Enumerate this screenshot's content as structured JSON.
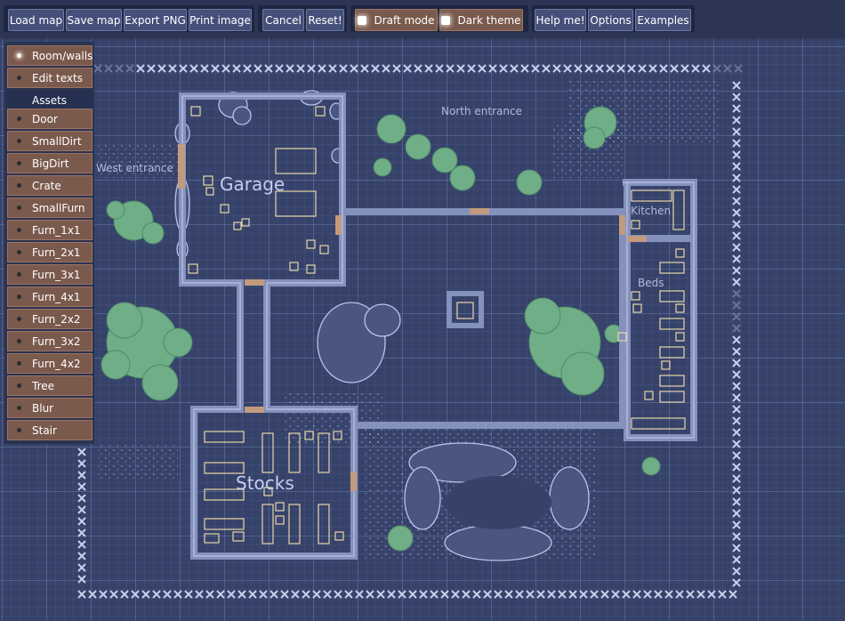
{
  "toolbar": {
    "file_buttons": [
      "Load map",
      "Save map",
      "Export PNG",
      "Print image"
    ],
    "edit_buttons": [
      "Cancel",
      "Reset!"
    ],
    "toggles": [
      {
        "label": "Draft mode",
        "checked": false
      },
      {
        "label": "Dark theme",
        "checked": false
      }
    ],
    "help_buttons": [
      "Help me!",
      "Options",
      "Examples"
    ]
  },
  "tool_panel": {
    "modes": [
      {
        "label": "Room/walls",
        "active": true
      },
      {
        "label": "Edit texts",
        "active": false
      }
    ],
    "assets_heading": "Assets",
    "assets": [
      "Door",
      "SmallDirt",
      "BigDirt",
      "Crate",
      "SmallFurn",
      "Furn_1x1",
      "Furn_2x1",
      "Furn_3x1",
      "Furn_4x1",
      "Furn_2x2",
      "Furn_3x2",
      "Furn_4x2",
      "Tree",
      "Blur",
      "Stair"
    ]
  },
  "map_labels": {
    "garage": "Garage",
    "stocks": "Stocks",
    "kitchen": "Kitchen",
    "beds": "Beds",
    "north_entrance": "North entrance",
    "west_entrance": "West entrance"
  },
  "colors": {
    "map_background": "#36426a",
    "wall": "#8591bd",
    "door": "#c29a7e",
    "tree": "#6fae86",
    "button_brown": "#7a5a4d",
    "button_blue": "#44507a"
  }
}
